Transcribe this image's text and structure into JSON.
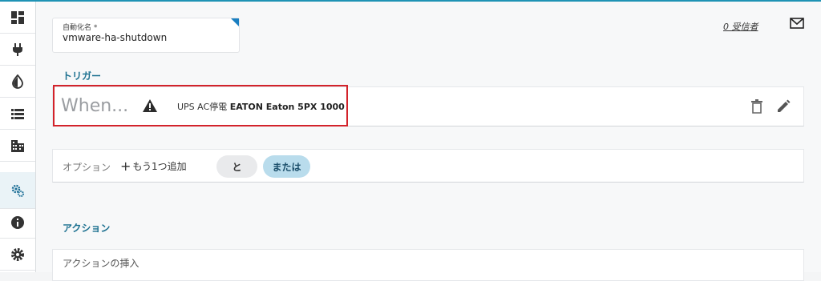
{
  "form": {
    "name_label": "自動化名 *",
    "name_value": "vmware-ha-shutdown",
    "recipients_link": "0 受信者"
  },
  "trigger": {
    "section_title": "トリガー",
    "when_text": "When...",
    "condition_prefix": "UPS AC停電",
    "condition_device": "EATON Eaton 5PX 1000"
  },
  "options": {
    "label": "オプション",
    "add_one": "もう1つ追加",
    "and_label": "と",
    "or_label": "または"
  },
  "actions": {
    "section_title": "アクション",
    "insert_label": "アクションの挿入"
  },
  "sidebar": {
    "items": [
      "dashboard-icon",
      "plug-icon",
      "contrast-icon",
      "list-icon",
      "building-icon",
      "gears-icon",
      "info-icon",
      "settings-icon"
    ],
    "active_index": 5
  },
  "colors": {
    "accent": "#1f93b5",
    "highlight_box": "#d3232b",
    "or_pill": "#b9dcec"
  }
}
